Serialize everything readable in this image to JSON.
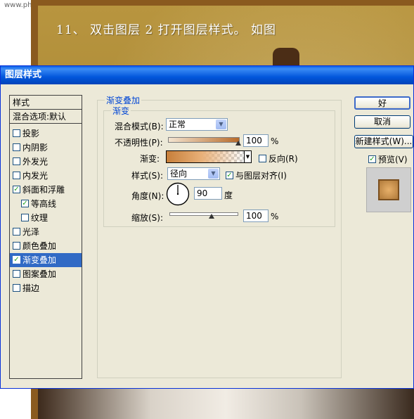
{
  "background": {
    "watermark": "www.photops.com",
    "instruction": "11、 双击图层 2 打开图层样式。 如图"
  },
  "dialog": {
    "title": "图层样式",
    "left_panel": {
      "header": "样式",
      "blend_options": "混合选项:默认",
      "items": [
        {
          "label": "投影",
          "checked": false,
          "indent": false
        },
        {
          "label": "内阴影",
          "checked": false,
          "indent": false
        },
        {
          "label": "外发光",
          "checked": false,
          "indent": false
        },
        {
          "label": "内发光",
          "checked": false,
          "indent": false
        },
        {
          "label": "斜面和浮雕",
          "checked": true,
          "indent": false
        },
        {
          "label": "等高线",
          "checked": true,
          "indent": true
        },
        {
          "label": "纹理",
          "checked": false,
          "indent": true
        },
        {
          "label": "光泽",
          "checked": false,
          "indent": false
        },
        {
          "label": "颜色叠加",
          "checked": false,
          "indent": false
        },
        {
          "label": "渐变叠加",
          "checked": true,
          "indent": false,
          "selected": true
        },
        {
          "label": "图案叠加",
          "checked": false,
          "indent": false
        },
        {
          "label": "描边",
          "checked": false,
          "indent": false
        }
      ]
    },
    "gradient_overlay": {
      "group_title": "渐变叠加",
      "sub_title": "渐变",
      "blend_mode_label": "混合模式(B):",
      "blend_mode_value": "正常",
      "opacity_label": "不透明性(P):",
      "opacity_value": "100",
      "opacity_unit": "%",
      "opacity_level": 1.0,
      "gradient_label": "渐变:",
      "gradient_colors": [
        "#c77f3a",
        "#e8b078",
        "#ffffff"
      ],
      "reverse_label": "反向(R)",
      "reverse_checked": false,
      "style_label": "样式(S):",
      "style_value": "径向",
      "align_label": "与图层对齐(I)",
      "align_checked": true,
      "angle_label": "角度(N):",
      "angle_value": "90",
      "angle_unit": "度",
      "scale_label": "缩放(S):",
      "scale_value": "100",
      "scale_unit": "%",
      "scale_level": 0.4
    },
    "buttons": {
      "ok": "好",
      "cancel": "取消",
      "new_style": "新建样式(W)...",
      "preview_label": "预览(V)",
      "preview_checked": true
    }
  }
}
